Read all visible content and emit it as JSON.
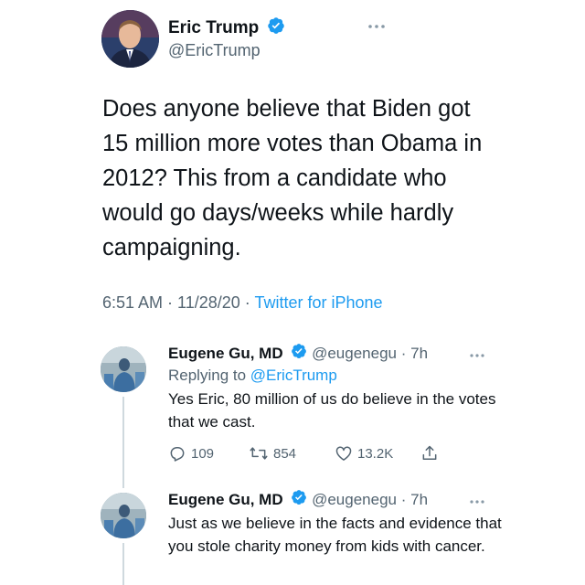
{
  "main_tweet": {
    "author_name": "Eric Trump",
    "author_handle": "@EricTrump",
    "text": "Does anyone believe that Biden got\n15 million more votes than Obama in\n2012? This from a candidate who\nwould go days/weeks while hardly\ncampaigning.",
    "time": "6:51 AM",
    "date": "11/28/20",
    "source": "Twitter for iPhone",
    "separator": " · "
  },
  "replies": [
    {
      "author_name": "Eugene Gu, MD",
      "author_handle": "@eugenegu",
      "age": "7h",
      "replying_prefix": "Replying to ",
      "replying_to": "@EricTrump",
      "text": "Yes Eric, 80 million of us do believe in the votes that we cast.",
      "counts": {
        "replies": "109",
        "retweets": "854",
        "likes": "13.2K"
      }
    },
    {
      "author_name": "Eugene Gu, MD",
      "author_handle": "@eugenegu",
      "age": "7h",
      "text": "Just as we believe in the facts and evidence that you stole charity money from kids with cancer."
    }
  ],
  "colors": {
    "text": "#0f1419",
    "secondary": "#536471",
    "link": "#1d9bf0",
    "verified": "#1d9bf0"
  },
  "icons": {
    "verified": "verified-badge-icon",
    "more": "more-options-icon",
    "reply": "reply-icon",
    "retweet": "retweet-icon",
    "like": "heart-icon",
    "share": "share-icon"
  }
}
